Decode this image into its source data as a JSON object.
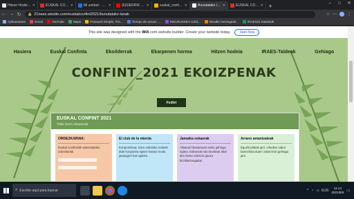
{
  "browser": {
    "tabs": [
      {
        "title": "Hitzen Hodeia - Ir",
        "color": "#e6e6e6"
      },
      {
        "title": "EUSKAL CONFINT",
        "color": "#d93025"
      },
      {
        "title": "Mi unidad - Goo",
        "color": "#1a73e8"
      },
      {
        "title": "(6)SIERRIK ASKO",
        "color": "#ff0000"
      },
      {
        "title": "euskal_confint_p",
        "color": "#f4b400"
      },
      {
        "title": "Bunutatako lanek",
        "color": "#ffffff",
        "active": true
      },
      {
        "title": "EUSKAL CONF",
        "color": "#d93025"
      }
    ],
    "url": "21iraes.wixsite.com/euskalconfint2021/bunutatako-lanak",
    "bookmarks": [
      {
        "label": "Aplicaciones",
        "color": "#8ab4f8"
      },
      {
        "label": "Gmail",
        "color": "#ea4335"
      },
      {
        "label": "YouTube",
        "color": "#ff0000"
      },
      {
        "label": "Maps",
        "color": "#34a853"
      },
      {
        "label": "Pneauert Simple, Pre...",
        "color": "#fbbc04"
      },
      {
        "label": "Tiempo de actuar -...",
        "color": "#4285f4"
      },
      {
        "label": "INKLRUSKEA-Celd...",
        "color": "#a142f4"
      },
      {
        "label": "Moodle hezzegesti...",
        "color": "#f57c00"
      },
      {
        "label": "IRAES21 Ikastolak",
        "color": "#0f9d58"
      }
    ]
  },
  "site": {
    "wix_message_pre": "This site was designed with the",
    "wix_brand": "WiX",
    "wix_message_post": ".com website builder. Create your website today.",
    "wix_button": "Start Now",
    "menu": [
      "Hasiera",
      "Euskal Confinta",
      "Ekoilderrak",
      "Ekarpenen horma",
      "Hitzen hodeia",
      "IRAES-Taldeak",
      "Gehiago"
    ],
    "page_title": "CONFINT_2021 EKOIZPENAK",
    "fedlet_button": "Fedlet",
    "embed": {
      "title": "EUSKAL CONFINT 2021",
      "subtitle": "Talde lanen ekarpenak",
      "columns": [
        {
          "heading": "ORDEZKARIAK:",
          "text": "Euskal Confintetik aukeratutako ordezkariak.",
          "color": "#f7c8a8"
        },
        {
          "heading": "El club de la mierda",
          "text": "Konpromisua: Gure eskolako erabaki dute konpostra egiten hastea modu jasangarri bat egiteko.",
          "color": "#bfe7f8"
        },
        {
          "heading": "Jamaika eskaerak",
          "text": "Alkatearí ikastetxean tailer gehiago egitea. Eskaerak edo bronkatu ahal den beste edozein gauza birziklatzeagaiak.",
          "color": "#dccdf0"
        },
        {
          "heading": "Arrano amantzaleak",
          "text": "Eguzki-plakak jarri. Urkullun zabor banezketa duten zaborontzi gehiago jarri.",
          "color": "#d9f0d7"
        }
      ]
    }
  },
  "taskbar": {
    "search_placeholder": "Escribe aquí para buscar",
    "language": "EUS",
    "time": "11:14",
    "date": "2021/5/5"
  }
}
